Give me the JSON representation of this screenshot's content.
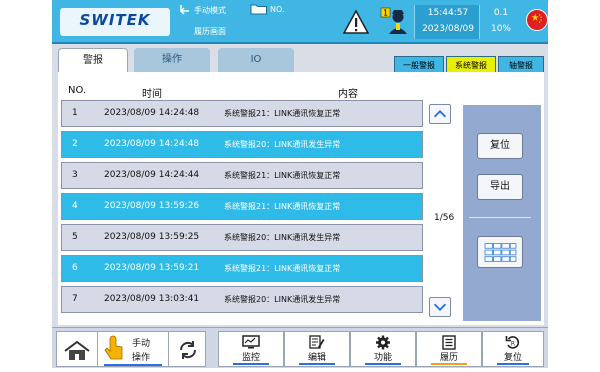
{
  "header": {
    "logo": "SWITEK",
    "mode_label": "手动模式",
    "program_label": "NO.",
    "screen_name": "履历画面",
    "time": "15:44:57",
    "date": "2023/08/09",
    "speed_value": "0.1",
    "override_percent": "10%"
  },
  "tabs": [
    "警报",
    "操作",
    "IO"
  ],
  "filters": {
    "general": "一般警报",
    "system": "系统警报",
    "axis": "轴警报"
  },
  "columns": {
    "no": "NO.",
    "time": "时间",
    "content": "内容"
  },
  "alarms": [
    {
      "no": "1",
      "time": "2023/08/09 14:24:48",
      "message": "系统警报21：LINK通讯恢复正常"
    },
    {
      "no": "2",
      "time": "2023/08/09 14:24:48",
      "message": "系统警报20：LINK通讯发生异常"
    },
    {
      "no": "3",
      "time": "2023/08/09 14:24:44",
      "message": "系统警报21：LINK通讯恢复正常"
    },
    {
      "no": "4",
      "time": "2023/08/09 13:59:26",
      "message": "系统警报21：LINK通讯恢复正常"
    },
    {
      "no": "5",
      "time": "2023/08/09 13:59:25",
      "message": "系统警报20：LINK通讯发生异常"
    },
    {
      "no": "6",
      "time": "2023/08/09 13:59:21",
      "message": "系统警报21：LINK通讯恢复正常"
    },
    {
      "no": "7",
      "time": "2023/08/09 13:03:41",
      "message": "系统警报20：LINK通讯发生异常"
    }
  ],
  "page_indicator": "1/56",
  "side_buttons": {
    "reset": "复位",
    "export": "导出"
  },
  "bottom_nav": {
    "manual_op_line1": "手动",
    "manual_op_line2": "操作",
    "monitor": "监控",
    "edit": "编辑",
    "function": "功能",
    "history": "履历",
    "reset": "复位"
  },
  "colors": {
    "header_blue": "#3fb6e3",
    "row_highlight": "#2fbbe8",
    "row_normal": "#d6dae6",
    "active_filter": "#e8f000",
    "history_active": "#f0a020"
  }
}
